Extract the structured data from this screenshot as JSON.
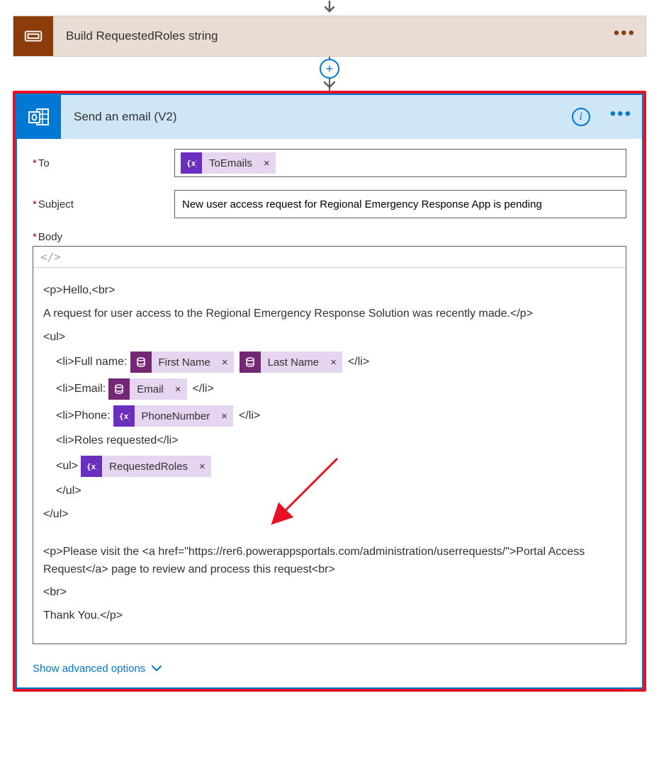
{
  "step1": {
    "title": "Build RequestedRoles string"
  },
  "step2": {
    "title": "Send an email (V2)"
  },
  "fields": {
    "to_label": "To",
    "subject_label": "Subject",
    "subject_value": "New user access request for Regional Emergency Response App is pending",
    "body_label": "Body"
  },
  "tokens": {
    "toEmails": "ToEmails",
    "firstName": "First Name",
    "lastName": "Last Name",
    "email": "Email",
    "phoneNumber": "PhoneNumber",
    "requestedRoles": "RequestedRoles"
  },
  "body": {
    "l1": "<p>Hello,<br>",
    "l2": "A request for user access to the Regional Emergency Response Solution was recently made.</p>",
    "l3": "<ul>",
    "l4a": "<li>Full name:",
    "l4b": "</li>",
    "l5a": "<li>Email:",
    "l5b": "</li>",
    "l6a": "<li>Phone:",
    "l6b": "</li>",
    "l7": "<li>Roles requested</li>",
    "l8": "<ul>",
    "l9": "</ul>",
    "l10": "</ul>",
    "l11": "<p>Please visit the <a href=\"https://rer6.powerappsportals.com/administration/userrequests/\">Portal Access Request</a> page to review and process this request<br>",
    "l12": "<br>",
    "l13": "Thank You.</p>"
  },
  "adv_label": "Show advanced options",
  "code_toggle": "</>"
}
